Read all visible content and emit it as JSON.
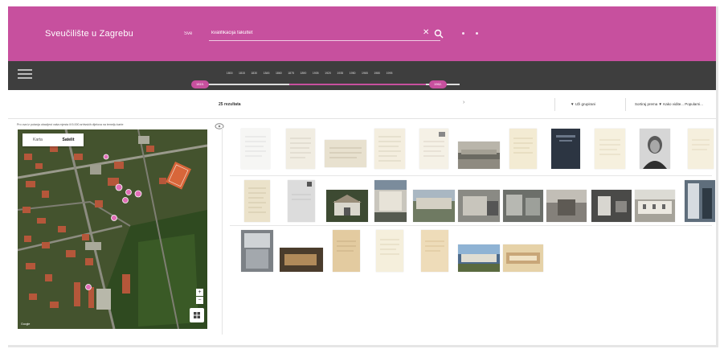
{
  "header": {
    "brand": "Sveučilište u Zagrebu",
    "search_scope": "Sve",
    "search_value": "kvalifikacija fakultet",
    "clear_icon": "close-icon",
    "search_icon": "search-icon"
  },
  "timeline": {
    "years": [
      "1800",
      "1815",
      "1830",
      "1845",
      "1860",
      "1875",
      "1890",
      "1905",
      "1920",
      "1935",
      "1950",
      "1965",
      "1980",
      "1995"
    ],
    "range_start": "1815.",
    "range_end": "1962."
  },
  "toolbar": {
    "results": "25 rezultata",
    "filter_label": "▼ Uži grupirani",
    "sort_label": "Sortiraj prema ▼ Kako vidite... Popularni..."
  },
  "map": {
    "note": "Pro ova iz putanja obavijest vaša mjesta ili 5.000 arhivskih dijelova na temelju karte",
    "tab_map": "Karta",
    "tab_satellite": "Satelit",
    "zoom_in": "+",
    "zoom_out": "−",
    "attribution": "Google"
  },
  "colors": {
    "brand": "#c7509e",
    "timeline_bg": "#3e3e3e"
  }
}
